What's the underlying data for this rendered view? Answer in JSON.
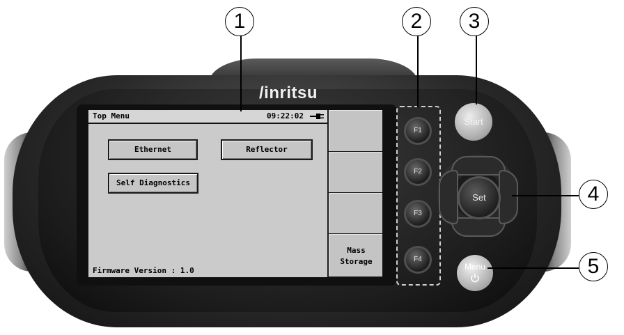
{
  "device": {
    "brand": "/inritsu"
  },
  "screen": {
    "title": "Top Menu",
    "clock": "09:22:02",
    "buttons": [
      "Ethernet",
      "Reflector",
      "Self Diagnostics"
    ],
    "firmware": "Firmware Version : 1.0",
    "softkeys": [
      {
        "line1": "",
        "line2": ""
      },
      {
        "line1": "",
        "line2": ""
      },
      {
        "line1": "",
        "line2": ""
      },
      {
        "line1": "Mass",
        "line2": "Storage"
      }
    ],
    "icons": {
      "power": "power-plug-icon"
    }
  },
  "hardkeys": {
    "function_keys": [
      "F1",
      "F2",
      "F3",
      "F4"
    ],
    "start": "Start",
    "set": "Set",
    "menu": "Menu"
  },
  "callouts": [
    "1",
    "2",
    "3",
    "4",
    "5"
  ],
  "colors": {
    "screen_bg": "#c8c8c8",
    "device_body": "#2a2a2a",
    "callout_border": "#000000"
  }
}
